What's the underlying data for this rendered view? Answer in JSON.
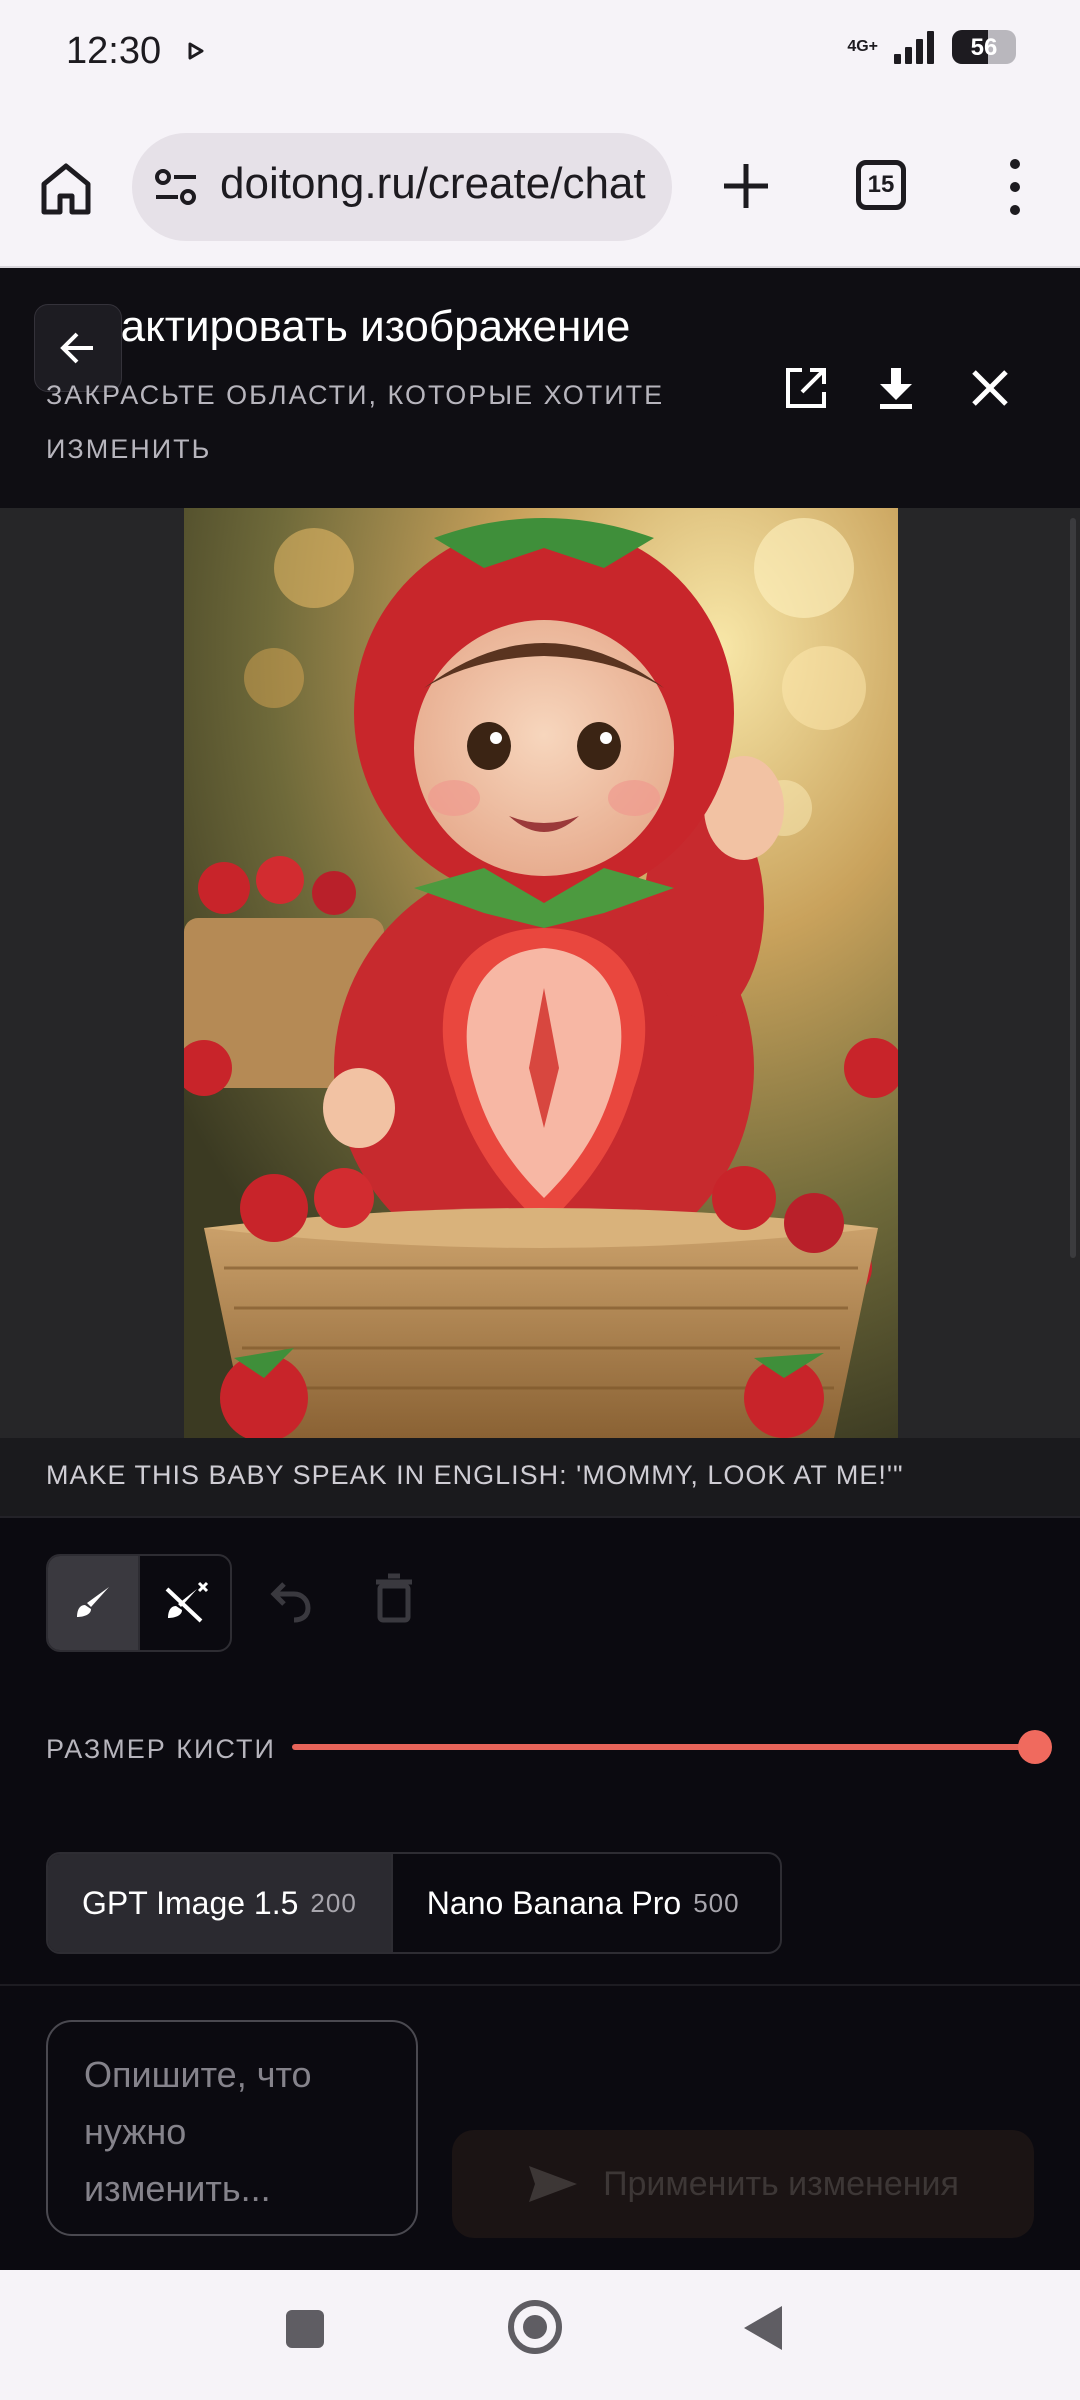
{
  "status_bar": {
    "time": "12:30",
    "network": "4G+",
    "battery": "56"
  },
  "browser": {
    "url": "doitong.ru/create/chat",
    "tab_count": "15"
  },
  "editor": {
    "title": "Редактировать изображение",
    "subtitle": "ЗАКРАСЬТЕ ОБЛАСТИ, КОТОРЫЕ ХОТИТЕ ИЗМЕНИТЬ",
    "prompt_caption": "MAKE THIS BABY SPEAK IN ENGLISH: 'MOMMY, LOOK AT ME!'\"",
    "brush_size_label": "РАЗМЕР КИСТИ",
    "brush_size_fraction": 1.0,
    "models": [
      {
        "name": "GPT Image 1.5",
        "cost": "200",
        "selected": true
      },
      {
        "name": "Nano Banana Pro",
        "cost": "500",
        "selected": false
      }
    ],
    "input_placeholder": "Опишите, что нужно изменить...",
    "apply_label": "Применить изменения"
  },
  "colors": {
    "accent": "#f06a5e",
    "panel": "#0b0a10",
    "image_bg": "#262628"
  }
}
